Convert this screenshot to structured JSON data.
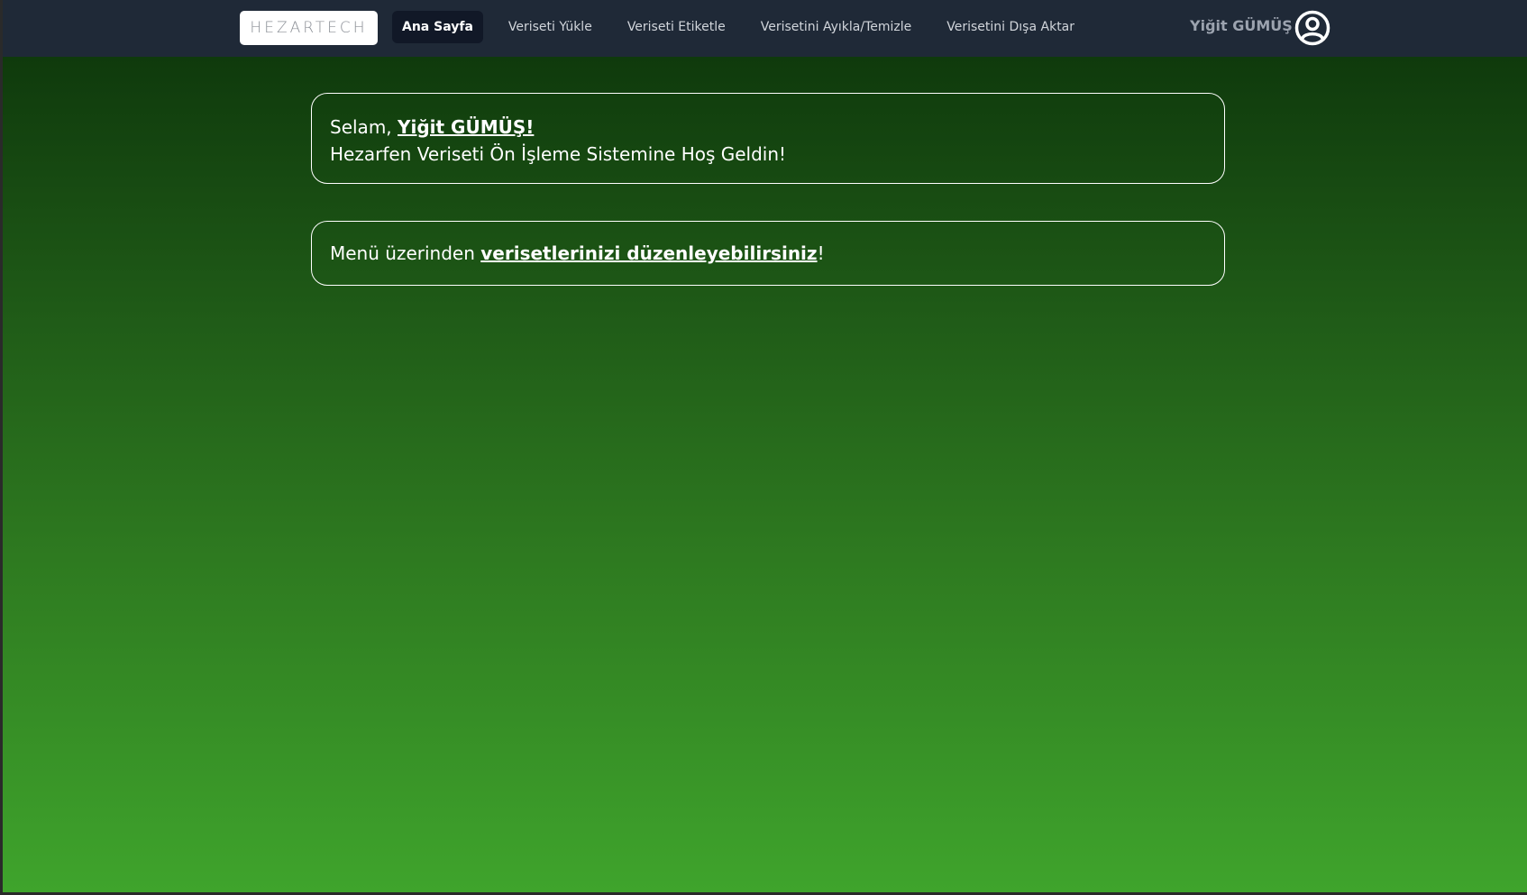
{
  "navbar": {
    "logo_text": "HEZARTECH",
    "links": [
      {
        "label": "Ana Sayfa",
        "active": true
      },
      {
        "label": "Veriseti Yükle",
        "active": false
      },
      {
        "label": "Veriseti Etiketle",
        "active": false
      },
      {
        "label": "Verisetini Ayıkla/Temizle",
        "active": false
      },
      {
        "label": "Verisetini Dışa Aktar",
        "active": false
      }
    ],
    "user_name": "Yiğit GÜMÜŞ",
    "user_icon": "user-circle-icon"
  },
  "welcome_card": {
    "greeting_prefix": "Selam, ",
    "greeting_name": "Yiğit GÜMÜŞ!",
    "message": "Hezarfen Veriseti Ön İşleme Sistemine Hoş Geldin!"
  },
  "info_card": {
    "prefix": "Menü üzerinden ",
    "link_text": "verisetlerinizi düzenleyebilirsiniz",
    "suffix": "!"
  },
  "colors": {
    "navbar_bg": "#1f2937",
    "active_link_bg": "#111827",
    "gradient_top": "#0f3a0c",
    "gradient_bottom": "#3fa42c"
  }
}
